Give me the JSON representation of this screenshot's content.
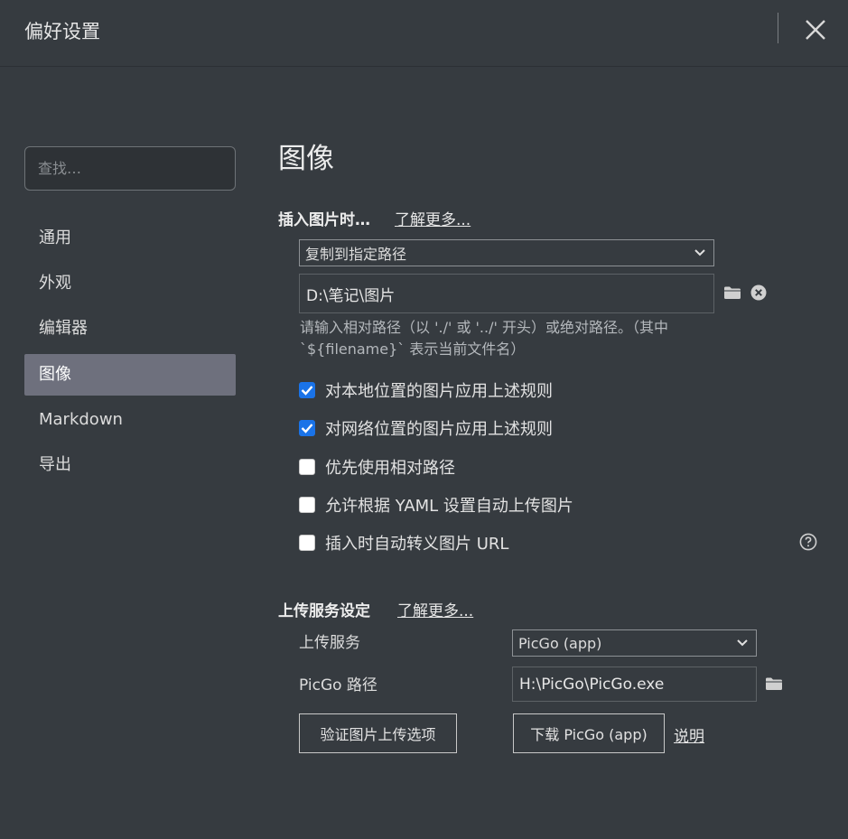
{
  "window": {
    "title": "偏好设置"
  },
  "search": {
    "placeholder": "查找…"
  },
  "sidebar": {
    "items": [
      {
        "label": "通用"
      },
      {
        "label": "外观"
      },
      {
        "label": "编辑器"
      },
      {
        "label": "图像",
        "active": true
      },
      {
        "label": "Markdown"
      },
      {
        "label": "导出"
      }
    ]
  },
  "main": {
    "title": "图像",
    "insert_section": {
      "label": "插入图片时…",
      "learn_more": "了解更多...",
      "action_select": "复制到指定路径",
      "path_value": "D:\\笔记\\图片",
      "hint": "请输入相对路径（以 './' 或 '../' 开头）或绝对路径。（其中 `${filename}` 表示当前文件名）",
      "options": [
        {
          "label": "对本地位置的图片应用上述规则",
          "checked": true
        },
        {
          "label": "对网络位置的图片应用上述规则",
          "checked": true
        },
        {
          "label": "优先使用相对路径",
          "checked": false
        },
        {
          "label": "允许根据 YAML 设置自动上传图片",
          "checked": false
        },
        {
          "label": "插入时自动转义图片 URL",
          "checked": false
        }
      ]
    },
    "upload_section": {
      "label": "上传服务设定",
      "learn_more": "了解更多...",
      "service_label": "上传服务",
      "service_value": "PicGo (app)",
      "path_label": "PicGo 路径",
      "path_value": "H:\\PicGo\\PicGo.exe",
      "verify_button": "验证图片上传选项",
      "download_button": "下载 PicGo (app)",
      "help_link": "说明"
    }
  },
  "colors": {
    "background": "#363b40",
    "active_nav": "#6e707d",
    "checkbox_accent": "#1a73e8"
  }
}
